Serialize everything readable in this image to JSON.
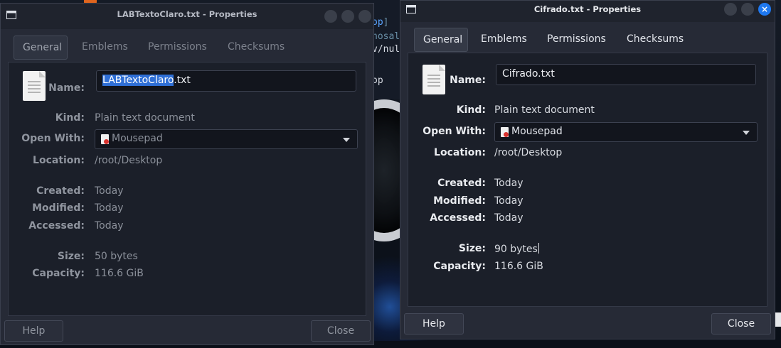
{
  "background": {
    "terminal_lines": [
      {
        "accent": "op",
        "rest": "]"
      },
      {
        "accent": "",
        "rest": "nosal"
      },
      {
        "accent": "",
        "rest": "v/nul"
      },
      {
        "accent": "",
        "rest": "op"
      }
    ]
  },
  "window_left": {
    "title": "LABTextoClaro.txt - Properties",
    "tabs": [
      "General",
      "Emblems",
      "Permissions",
      "Checksums"
    ],
    "name_label": "Name:",
    "name_selected": "LABTextoClaro",
    "name_rest": ".txt",
    "rows": {
      "kind": {
        "label": "Kind:",
        "value": "Plain text document"
      },
      "open_with": {
        "label": "Open With:",
        "value": "Mousepad"
      },
      "location": {
        "label": "Location:",
        "value": "/root/Desktop"
      },
      "created": {
        "label": "Created:",
        "value": "Today"
      },
      "modified": {
        "label": "Modified:",
        "value": "Today"
      },
      "accessed": {
        "label": "Accessed:",
        "value": "Today"
      },
      "size": {
        "label": "Size:",
        "value": "50 bytes"
      },
      "capacity": {
        "label": "Capacity:",
        "value": "116.6 GiB"
      }
    },
    "help_label": "Help",
    "close_label": "Close"
  },
  "window_right": {
    "title": "Cifrado.txt - Properties",
    "tabs": [
      "General",
      "Emblems",
      "Permissions",
      "Checksums"
    ],
    "name_label": "Name:",
    "name_value": "Cifrado.txt",
    "rows": {
      "kind": {
        "label": "Kind:",
        "value": "Plain text document"
      },
      "open_with": {
        "label": "Open With:",
        "value": "Mousepad"
      },
      "location": {
        "label": "Location:",
        "value": "/root/Desktop"
      },
      "created": {
        "label": "Created:",
        "value": "Today"
      },
      "modified": {
        "label": "Modified:",
        "value": "Today"
      },
      "accessed": {
        "label": "Accessed:",
        "value": "Today"
      },
      "size": {
        "label": "Size:",
        "value": "90 bytes"
      },
      "capacity": {
        "label": "Capacity:",
        "value": "116.6 GiB"
      }
    },
    "help_label": "Help",
    "close_label": "Close",
    "close_icon": "×"
  },
  "colors": {
    "accent_selection": "#2f6fd6",
    "close_button_active": "#1e78f0",
    "window_bg": "#262a36",
    "panel_bg": "#1b1f29"
  }
}
